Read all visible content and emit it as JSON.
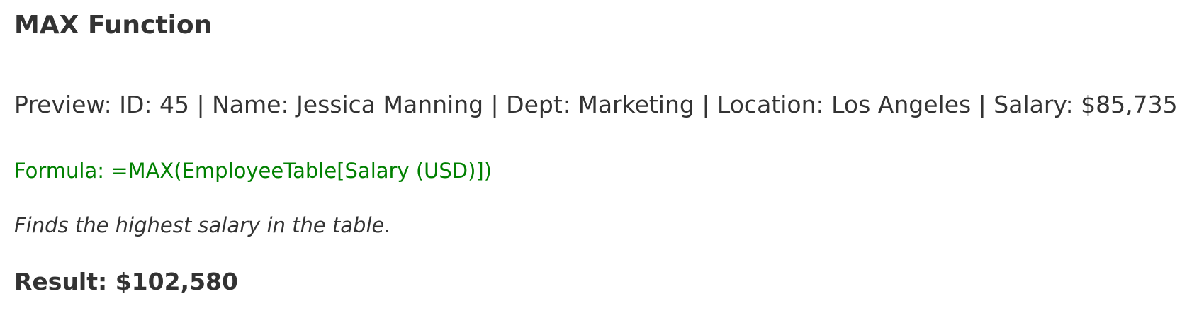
{
  "title": "MAX Function",
  "preview": "Preview: ID: 45 | Name: Jessica Manning | Dept: Marketing | Location: Los Angeles | Salary: $85,735",
  "formula": "Formula: =MAX(EmployeeTable[Salary (USD)])",
  "description": "Finds the highest salary in the table.",
  "result": "Result: $102,580",
  "colors": {
    "text": "#333333",
    "formula": "#008000",
    "background": "#ffffff"
  }
}
